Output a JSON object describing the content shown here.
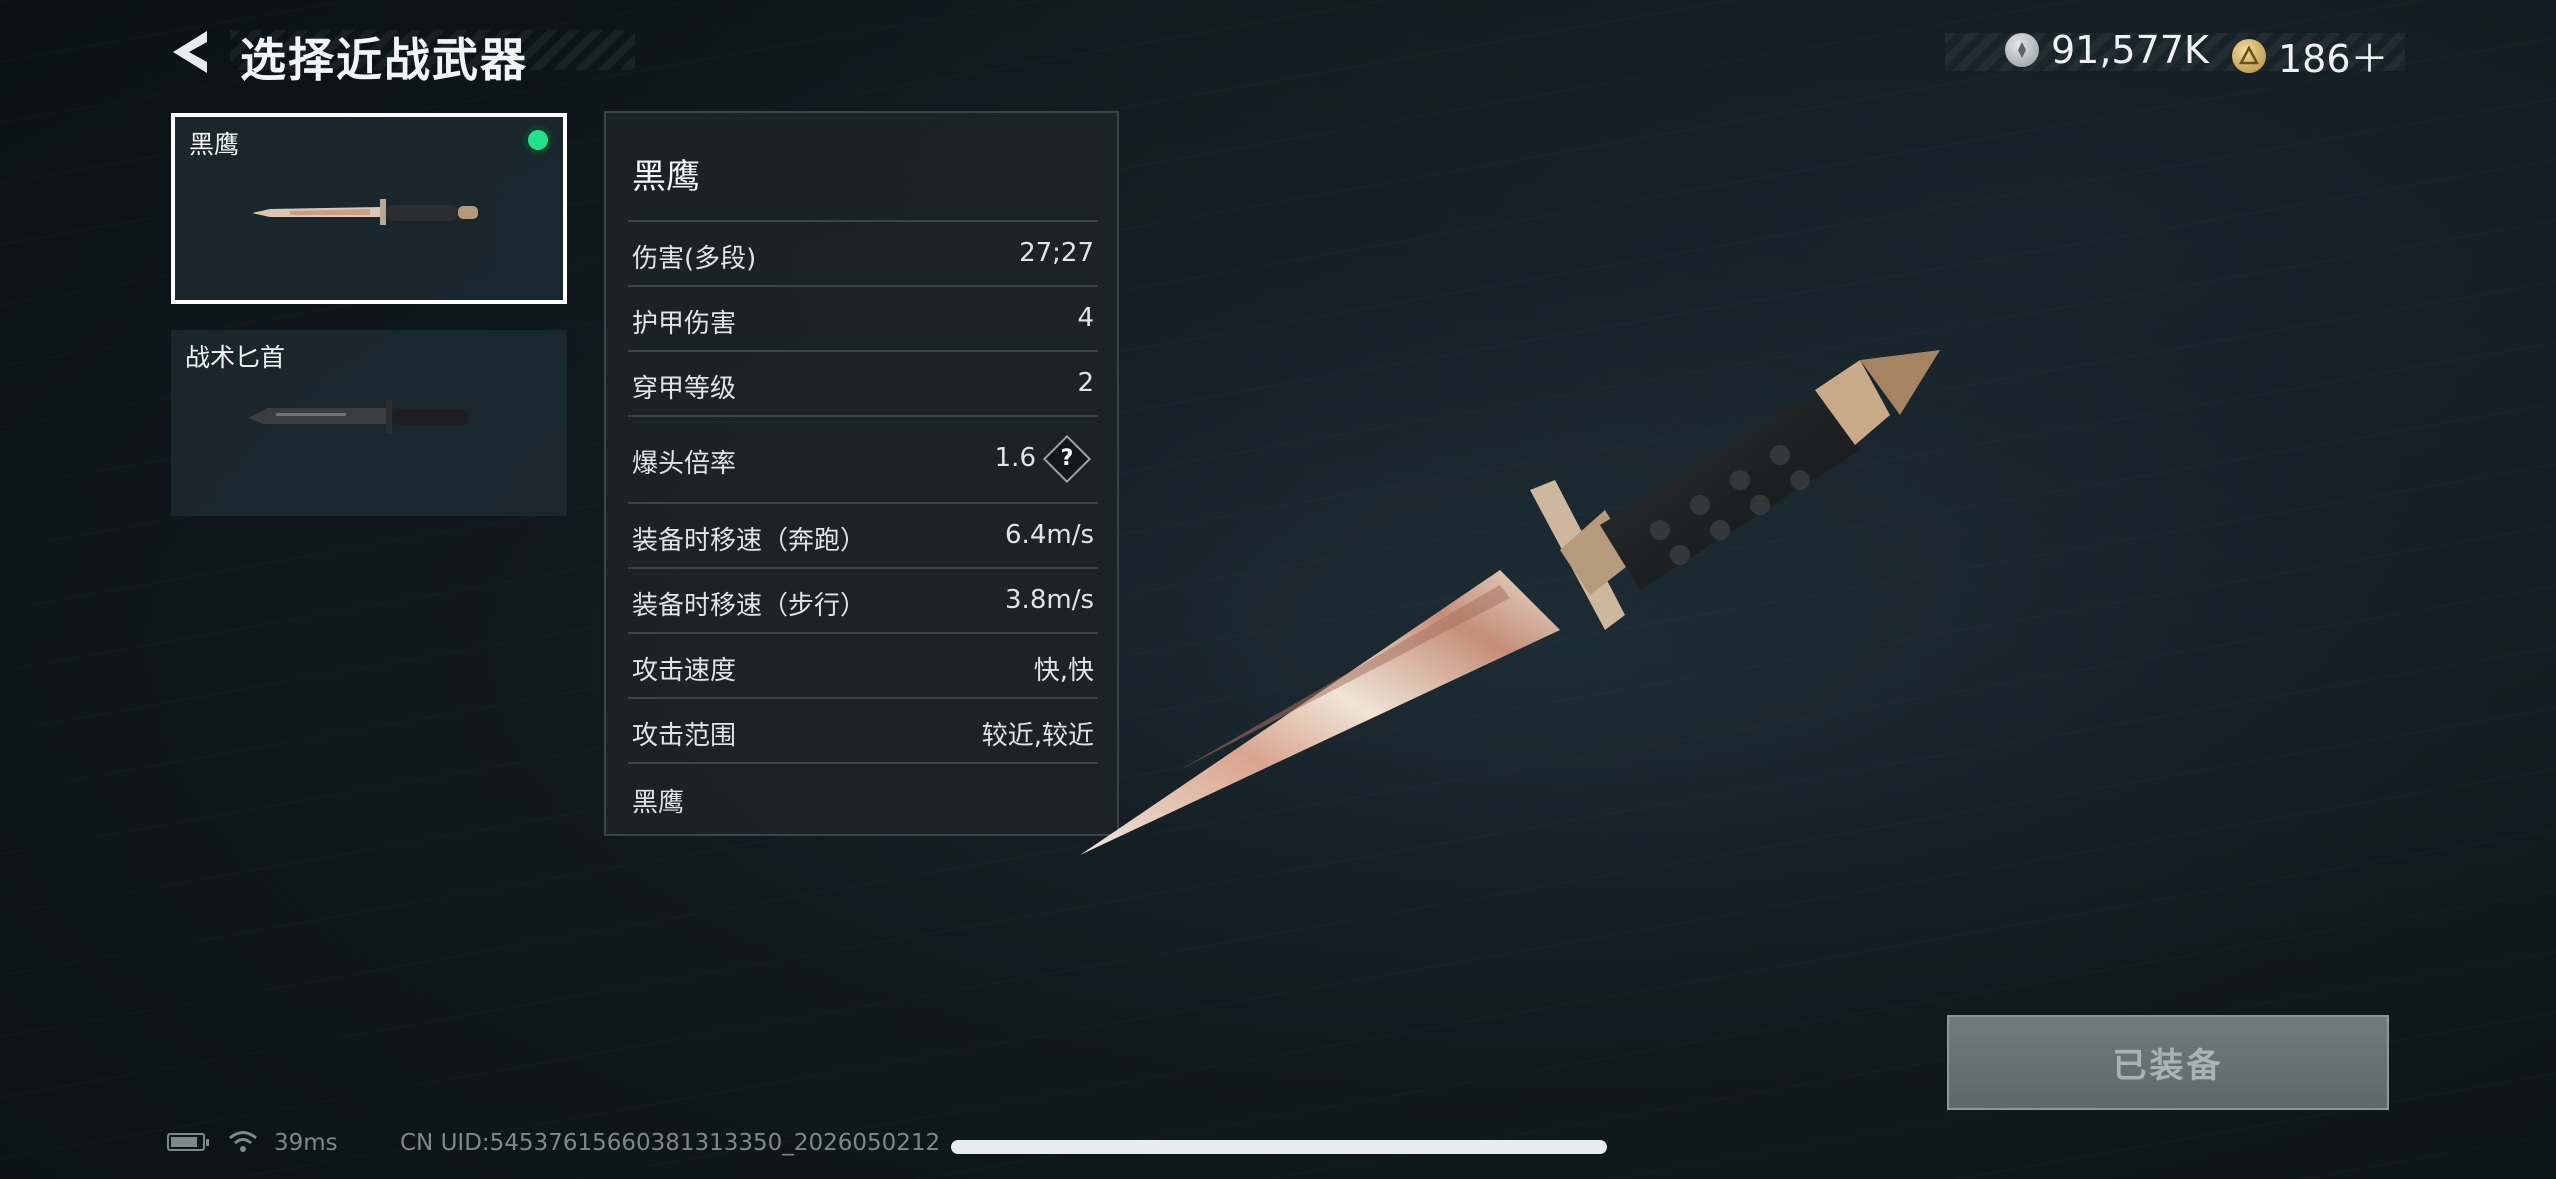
{
  "header": {
    "title": "选择近战武器",
    "back_icon": "back-arrow-icon"
  },
  "currency": {
    "silver": {
      "icon": "silver-coin-icon",
      "value": "91,577K"
    },
    "gold": {
      "icon": "gold-coin-icon",
      "value": "186＋"
    }
  },
  "weapons": [
    {
      "name": "黑鹰",
      "selected": true,
      "equipped": true
    },
    {
      "name": "战术匕首",
      "selected": false,
      "equipped": false
    }
  ],
  "stats": {
    "title": "黑鹰",
    "rows": [
      {
        "label": "伤害(多段)",
        "value": "27;27"
      },
      {
        "label": "护甲伤害",
        "value": "4"
      },
      {
        "label": "穿甲等级",
        "value": "2"
      },
      {
        "label": "爆头倍率",
        "value": "1.6",
        "help": "?"
      },
      {
        "label": "装备时移速（奔跑）",
        "value": "6.4m/s"
      },
      {
        "label": "装备时移速（步行）",
        "value": "3.8m/s"
      },
      {
        "label": "攻击速度",
        "value": "快,快"
      },
      {
        "label": "攻击范围",
        "value": "较近,较近"
      }
    ],
    "footer": "黑鹰"
  },
  "equip_button": {
    "label": "已装备"
  },
  "status_bar": {
    "ping": "39ms",
    "uid": "CN UID:54537615660381313350_2026050212"
  },
  "colors": {
    "accent_green": "#1ee389",
    "panel_bg": "#1c2428",
    "background": "#10191e"
  }
}
